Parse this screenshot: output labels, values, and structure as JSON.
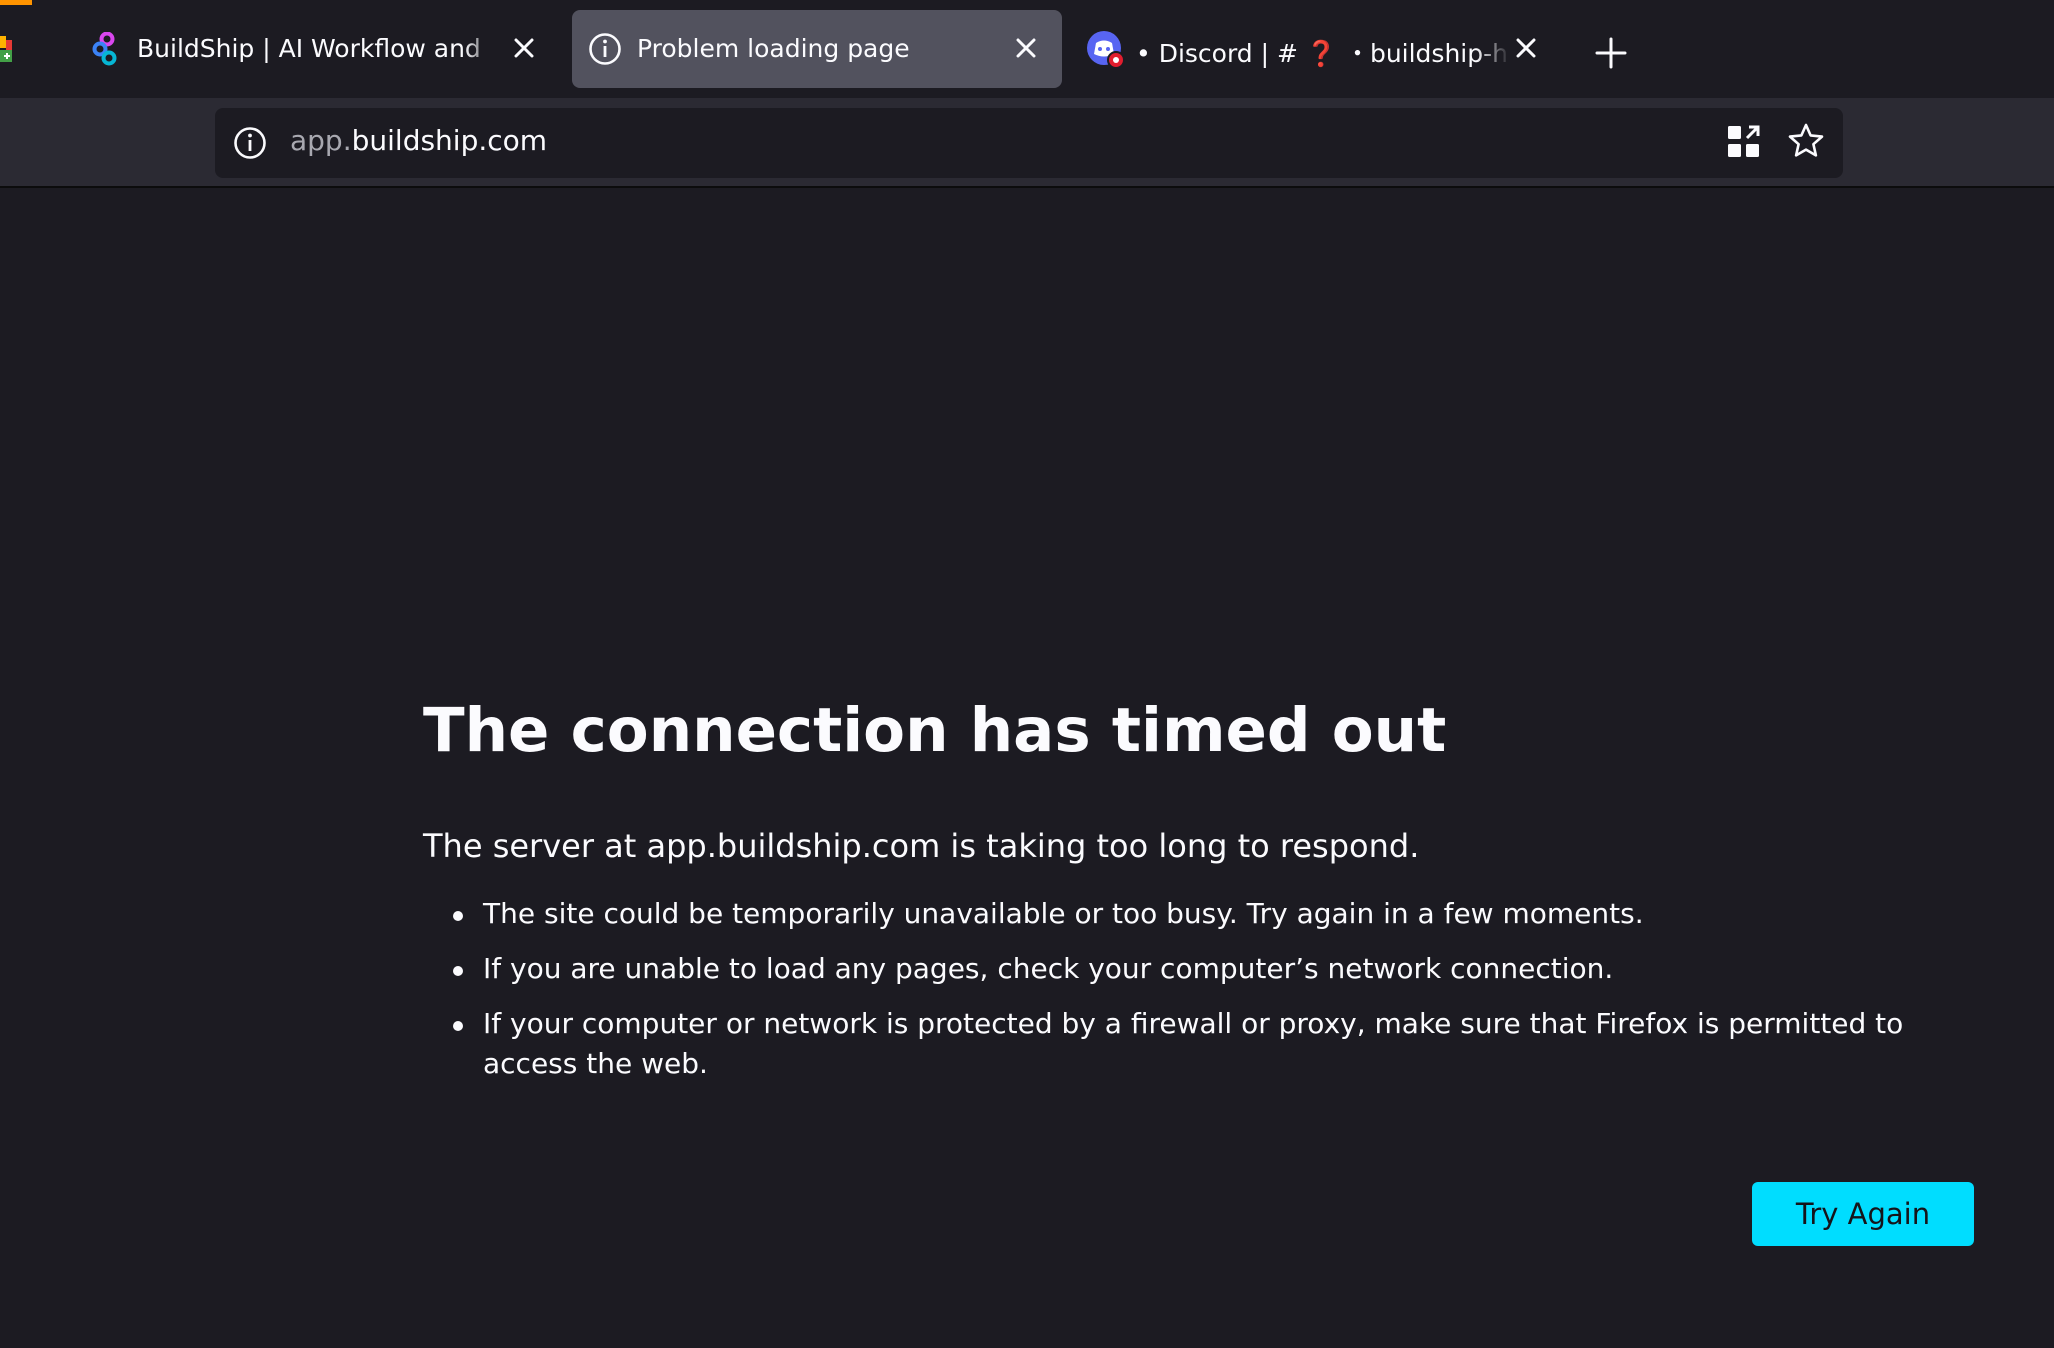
{
  "tabs": [
    {
      "title": "BuildShip | AI Workflow and Backend",
      "icon": "buildship-logo-icon",
      "active": false
    },
    {
      "title": "Problem loading page",
      "icon": "info-icon",
      "active": true
    },
    {
      "title": "• Discord | # ❓ ・buildship-help | B",
      "icon": "discord-icon",
      "active": false
    }
  ],
  "urlbar": {
    "url_prefix": "app.",
    "url_domain": "buildship.com"
  },
  "error": {
    "heading": "The connection has timed out",
    "description": "The server at app.buildship.com is taking too long to respond.",
    "reasons": [
      "The site could be temporarily unavailable or too busy. Try again in a few moments.",
      "If you are unable to load any pages, check your computer’s network connection.",
      "If your computer or network is protected by a firewall or proxy, make sure that Firefox is permitted to access the web."
    ],
    "button_label": "Try Again"
  },
  "colors": {
    "background": "#1c1b22",
    "toolbar": "#2b2a33",
    "active_tab": "#52525e",
    "accent_button": "#00ddff",
    "loading_indicator": "#ff9400"
  }
}
